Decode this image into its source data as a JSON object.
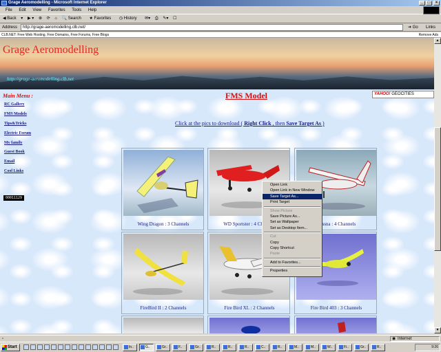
{
  "window": {
    "title": "Grage Aeromodelling - Microsoft Internet Explorer"
  },
  "menubar": [
    "File",
    "Edit",
    "View",
    "Favorites",
    "Tools",
    "Help"
  ],
  "toolbar": {
    "back": "Back",
    "search": "Search",
    "favorites": "Favorites",
    "history": "History"
  },
  "address": {
    "label": "Address",
    "value": "http://grage-aeromodelling.clb.net/",
    "go": "Go",
    "links": "Links"
  },
  "adbar": {
    "left": "CLB.NET: Free Web Hosting, Free Domains, Free Forums, Free Blogs",
    "right": "Remove Ads"
  },
  "site": {
    "title": "Grage Aeromodelling",
    "url": "http://grage-aeromodelling.clb.net",
    "page_title": "FMS Model",
    "geocities": {
      "yahoo": "YAHOO!",
      "geo": "GEOCITIES"
    }
  },
  "nav": {
    "heading": "Main Menu :",
    "items": [
      "RC Gallery",
      "FMS Models",
      "Tips&Tricks",
      "Electric Forum",
      "My family",
      "Guest Book",
      "Email",
      "Cool Links"
    ],
    "counter": "00011129"
  },
  "instruction": {
    "pre": "Click  at the  pics  to  download ( ",
    "rc": "Right Click",
    "mid": " , then ",
    "sta": "Save Target As",
    "post": " )"
  },
  "models": [
    {
      "name": "Wing Dragon : 3 Channels"
    },
    {
      "name": "WD Sportster : 4 Channels"
    },
    {
      "name": "Cessna : 4 Channels"
    },
    {
      "name": "FireBird II : 2 Channels"
    },
    {
      "name": "Fire Bird XL : 2 Channels"
    },
    {
      "name": "Fire Bird 403 : 3 Channels"
    }
  ],
  "context_menu": [
    {
      "label": "Open Link",
      "state": "normal"
    },
    {
      "label": "Open Link in New Window",
      "state": "normal"
    },
    {
      "label": "Save Target As...",
      "state": "selected"
    },
    {
      "label": "Print Target",
      "state": "normal"
    },
    {
      "sep": true
    },
    {
      "label": "Show Picture",
      "state": "disabled"
    },
    {
      "label": "Save Picture As...",
      "state": "normal"
    },
    {
      "label": "Set as Wallpaper",
      "state": "normal"
    },
    {
      "label": "Set as Desktop Item...",
      "state": "normal"
    },
    {
      "sep": true
    },
    {
      "label": "Cut",
      "state": "disabled"
    },
    {
      "label": "Copy",
      "state": "normal"
    },
    {
      "label": "Copy Shortcut",
      "state": "normal"
    },
    {
      "label": "Paste",
      "state": "disabled"
    },
    {
      "sep": true
    },
    {
      "label": "Add to Favorites...",
      "state": "normal"
    },
    {
      "sep": true
    },
    {
      "label": "Properties",
      "state": "normal"
    }
  ],
  "status": {
    "zone": "Internet"
  },
  "taskbar": {
    "start": "Start",
    "tasks": [
      "In..",
      "G..",
      "Gr..",
      "F..",
      "Gr..",
      "R..",
      "R..",
      "R..",
      "C..",
      "R..",
      "M..",
      "M..",
      "W..",
      "Fi..",
      "Gr..",
      "R.."
    ],
    "clock": "9:26"
  },
  "colors": {
    "title_red": "#d01010",
    "link_blue": "#1a1a80",
    "selection": "#0a246a"
  }
}
